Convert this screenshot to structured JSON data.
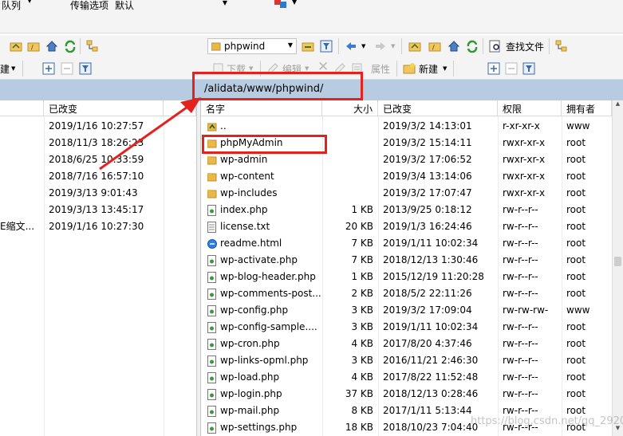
{
  "top": {
    "queue_label": "队列",
    "transfer_label": "传输选项",
    "transfer_value": "默认"
  },
  "toolbar": {
    "remote_location": "phpwind",
    "find_files": "查找文件",
    "download": "下载",
    "edit": "编辑",
    "properties": "属性",
    "new_label": "新建",
    "left_new_label": "建"
  },
  "path": "/alidata/www/phpwind/",
  "left": {
    "col_modified": "已改变",
    "rows": [
      {
        "name": "",
        "modified": "2019/1/16  10:27:57"
      },
      {
        "name": "",
        "modified": "2018/11/3  18:26:23"
      },
      {
        "name": "",
        "modified": "2018/6/25  10:33:59"
      },
      {
        "name": "",
        "modified": "2018/7/16  16:57:10"
      },
      {
        "name": "",
        "modified": "2019/3/13  9:01:43"
      },
      {
        "name": "",
        "modified": "2019/3/13  13:45:17"
      },
      {
        "name": "E缩文...",
        "modified": "2019/1/16  10:27:30"
      }
    ]
  },
  "right": {
    "columns": {
      "name": "名字",
      "size": "大小",
      "modified": "已改变",
      "perms": "权限",
      "owner": "拥有者"
    },
    "rows": [
      {
        "icon": "parent-dir-icon",
        "name": "..",
        "size": "",
        "modified": "2019/3/2 14:13:01",
        "perms": "r-xr-xr-x",
        "owner": "www"
      },
      {
        "icon": "folder-icon",
        "name": "phpMyAdmin",
        "size": "",
        "modified": "2019/3/2 15:14:11",
        "perms": "rwxr-xr-x",
        "owner": "root"
      },
      {
        "icon": "folder-icon",
        "name": "wp-admin",
        "size": "",
        "modified": "2019/3/2 17:06:52",
        "perms": "rwxr-xr-x",
        "owner": "root"
      },
      {
        "icon": "folder-icon",
        "name": "wp-content",
        "size": "",
        "modified": "2019/3/4 13:14:06",
        "perms": "rwxr-xr-x",
        "owner": "root"
      },
      {
        "icon": "folder-icon",
        "name": "wp-includes",
        "size": "",
        "modified": "2019/3/2 17:07:47",
        "perms": "rwxr-xr-x",
        "owner": "root"
      },
      {
        "icon": "php-file-icon",
        "name": "index.php",
        "size": "1 KB",
        "modified": "2013/9/25 0:18:12",
        "perms": "rw-r--r--",
        "owner": "root"
      },
      {
        "icon": "text-file-icon",
        "name": "license.txt",
        "size": "20 KB",
        "modified": "2019/1/3 16:24:46",
        "perms": "rw-r--r--",
        "owner": "root"
      },
      {
        "icon": "html-file-icon",
        "name": "readme.html",
        "size": "7 KB",
        "modified": "2019/1/11 10:02:34",
        "perms": "rw-r--r--",
        "owner": "root"
      },
      {
        "icon": "php-file-icon",
        "name": "wp-activate.php",
        "size": "7 KB",
        "modified": "2018/12/13 1:30:46",
        "perms": "rw-r--r--",
        "owner": "root"
      },
      {
        "icon": "php-file-icon",
        "name": "wp-blog-header.php",
        "size": "1 KB",
        "modified": "2015/12/19 11:20:28",
        "perms": "rw-r--r--",
        "owner": "root"
      },
      {
        "icon": "php-file-icon",
        "name": "wp-comments-post...",
        "size": "2 KB",
        "modified": "2018/5/2 22:11:26",
        "perms": "rw-r--r--",
        "owner": "root"
      },
      {
        "icon": "php-file-icon",
        "name": "wp-config.php",
        "size": "3 KB",
        "modified": "2019/3/2 17:09:04",
        "perms": "rw-rw-rw-",
        "owner": "www"
      },
      {
        "icon": "php-file-icon",
        "name": "wp-config-sample....",
        "size": "3 KB",
        "modified": "2019/1/11 10:02:34",
        "perms": "rw-r--r--",
        "owner": "root"
      },
      {
        "icon": "php-file-icon",
        "name": "wp-cron.php",
        "size": "4 KB",
        "modified": "2017/8/20 4:37:46",
        "perms": "rw-r--r--",
        "owner": "root"
      },
      {
        "icon": "php-file-icon",
        "name": "wp-links-opml.php",
        "size": "3 KB",
        "modified": "2016/11/21 2:46:30",
        "perms": "rw-r--r--",
        "owner": "root"
      },
      {
        "icon": "php-file-icon",
        "name": "wp-load.php",
        "size": "4 KB",
        "modified": "2017/8/22 11:52:48",
        "perms": "rw-r--r--",
        "owner": "root"
      },
      {
        "icon": "php-file-icon",
        "name": "wp-login.php",
        "size": "37 KB",
        "modified": "2018/12/13 0:28:46",
        "perms": "rw-r--r--",
        "owner": "root"
      },
      {
        "icon": "php-file-icon",
        "name": "wp-mail.php",
        "size": "8 KB",
        "modified": "2017/1/11 5:13:44",
        "perms": "rw-r--r--",
        "owner": "root"
      },
      {
        "icon": "php-file-icon",
        "name": "wp-settings.php",
        "size": "18 KB",
        "modified": "2018/10/23 7:04:40",
        "perms": "rw-r--r--",
        "owner": "root"
      }
    ]
  },
  "watermark": "https://blog.csdn.net/qq_2920xian",
  "colors": {
    "highlight": "#e5211e",
    "path_bar": "#b7cbe1",
    "folder": "#e8b84a"
  }
}
